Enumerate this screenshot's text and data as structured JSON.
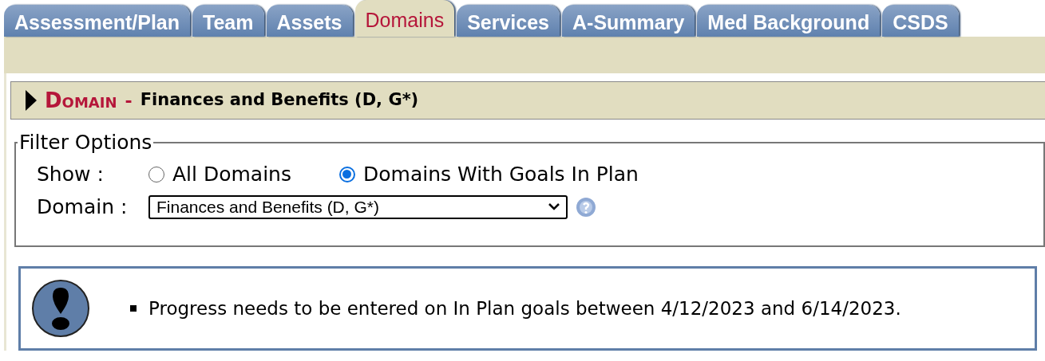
{
  "tabs": [
    {
      "label": "Assessment/Plan",
      "selected": false
    },
    {
      "label": "Team",
      "selected": false
    },
    {
      "label": "Assets",
      "selected": false
    },
    {
      "label": "Domains",
      "selected": true
    },
    {
      "label": "Services",
      "selected": false
    },
    {
      "label": "A-Summary",
      "selected": false
    },
    {
      "label": "Med Background",
      "selected": false
    },
    {
      "label": "CSDS",
      "selected": false
    }
  ],
  "section": {
    "expanded": false,
    "label": "Domain",
    "separator": "-",
    "title": "Finances and Benefits (D, G*)"
  },
  "filter": {
    "legend": "Filter Options",
    "show_label": "Show :",
    "options": [
      {
        "label": "All Domains",
        "selected": false
      },
      {
        "label": "Domains With Goals In Plan",
        "selected": true
      }
    ],
    "domain_label": "Domain :",
    "domain_value": "Finances and Benefits (D, G*)"
  },
  "messages": [
    "Progress needs to be entered on In Plan goals between 4/12/2023 and 6/14/2023."
  ]
}
